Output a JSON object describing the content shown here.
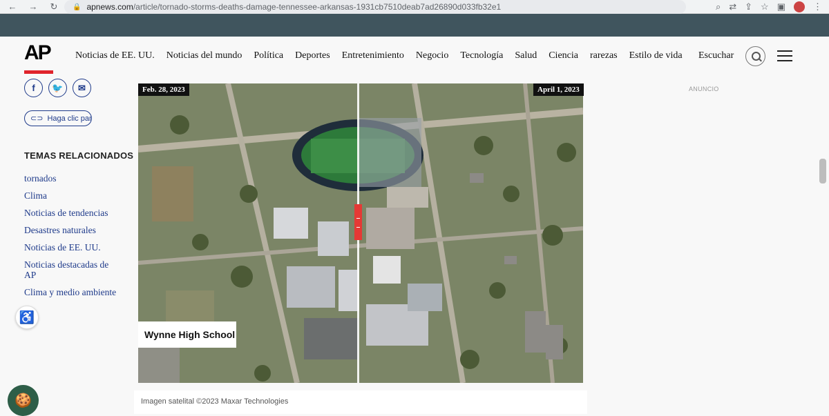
{
  "browser": {
    "url_domain": "apnews.com",
    "url_path": "/article/tornado-storms-deaths-damage-tennessee-arkansas-1931cb7510deab7ad26890d033fb32e1"
  },
  "header": {
    "logo": "AP",
    "nav": [
      "Noticias de EE. UU.",
      "Noticias del mundo",
      "Política",
      "Deportes",
      "Entretenimiento",
      "Negocio",
      "Tecnología",
      "Salud",
      "Ciencia",
      "rarezas",
      "Estilo de vida"
    ],
    "listen": "Escuchar"
  },
  "sidebar": {
    "click_label": "Haga clic para",
    "topics_title": "TEMAS RELACIONADOS",
    "topics": [
      "tornados",
      "Clima",
      "Noticias de tendencias",
      "Desastres naturales",
      "Noticias de EE. UU.",
      "Noticias destacadas de AP",
      "Clima y medio ambiente"
    ]
  },
  "figure": {
    "date_left": "Feb. 28, 2023",
    "date_right": "April 1, 2023",
    "label": "Wynne High School",
    "caption": "Imagen satelital ©2023 Maxar Technologies",
    "slider_position_pct": 49.5
  },
  "ad_label": "ANUNCIO",
  "colors": {
    "banner": "#40555e",
    "accent_red": "#e0242b",
    "link_blue": "#1e3a8a"
  }
}
